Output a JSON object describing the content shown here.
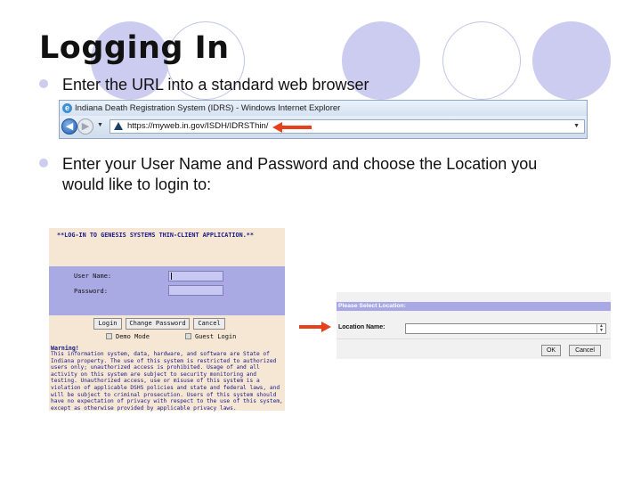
{
  "slide": {
    "title": "Logging In",
    "bullet1": "Enter the URL into a standard web browser",
    "bullet2_line1": "Enter your User Name and Password and choose the Location you",
    "bullet2_line2": "would like to login to:"
  },
  "colors": {
    "accent_circle": "#ccccf0",
    "arrow": "#e8401c",
    "panel_band": "#a9a9e3",
    "login_text": "#18188a"
  },
  "browser": {
    "window_title": "Indiana Death Registration System (IDRS) - Windows Internet Explorer",
    "url": "https://myweb.in.gov/ISDH/IDRSThin/",
    "icons": [
      "ie-logo-icon",
      "back-arrow-icon",
      "forward-arrow-icon",
      "dropdown-icon",
      "page-icon"
    ]
  },
  "login": {
    "header": "**LOG-IN TO GENESIS SYSTEMS THIN-CLIENT APPLICATION.**",
    "username_label": "User Name:",
    "password_label": "Password:",
    "username_value": "",
    "password_value": "",
    "buttons": {
      "login": "Login",
      "change_password": "Change Password",
      "cancel": "Cancel"
    },
    "demo_mode_label": "Demo Mode",
    "guest_login_label": "Guest Login",
    "warning_title": "Warning!",
    "warning_text": "This information system, data, hardware, and software are State of Indiana property. The use of this system is restricted to authorized users only; unauthorized access is prohibited. Usage of and all activity on this system are subject to security monitoring and testing. Unauthorized access, use or misuse of this system is a violation of applicable DSHS policies and state and federal laws, and will be subject to criminal prosecution. Users of this system should have no expectation of privacy with respect to the use of this system, except as otherwise provided by applicable privacy laws."
  },
  "location": {
    "band_label": "Please Select Location:",
    "field_label": "Location Name:",
    "selected_value": "",
    "ok_button": "OK",
    "cancel_button": "Cancel"
  }
}
